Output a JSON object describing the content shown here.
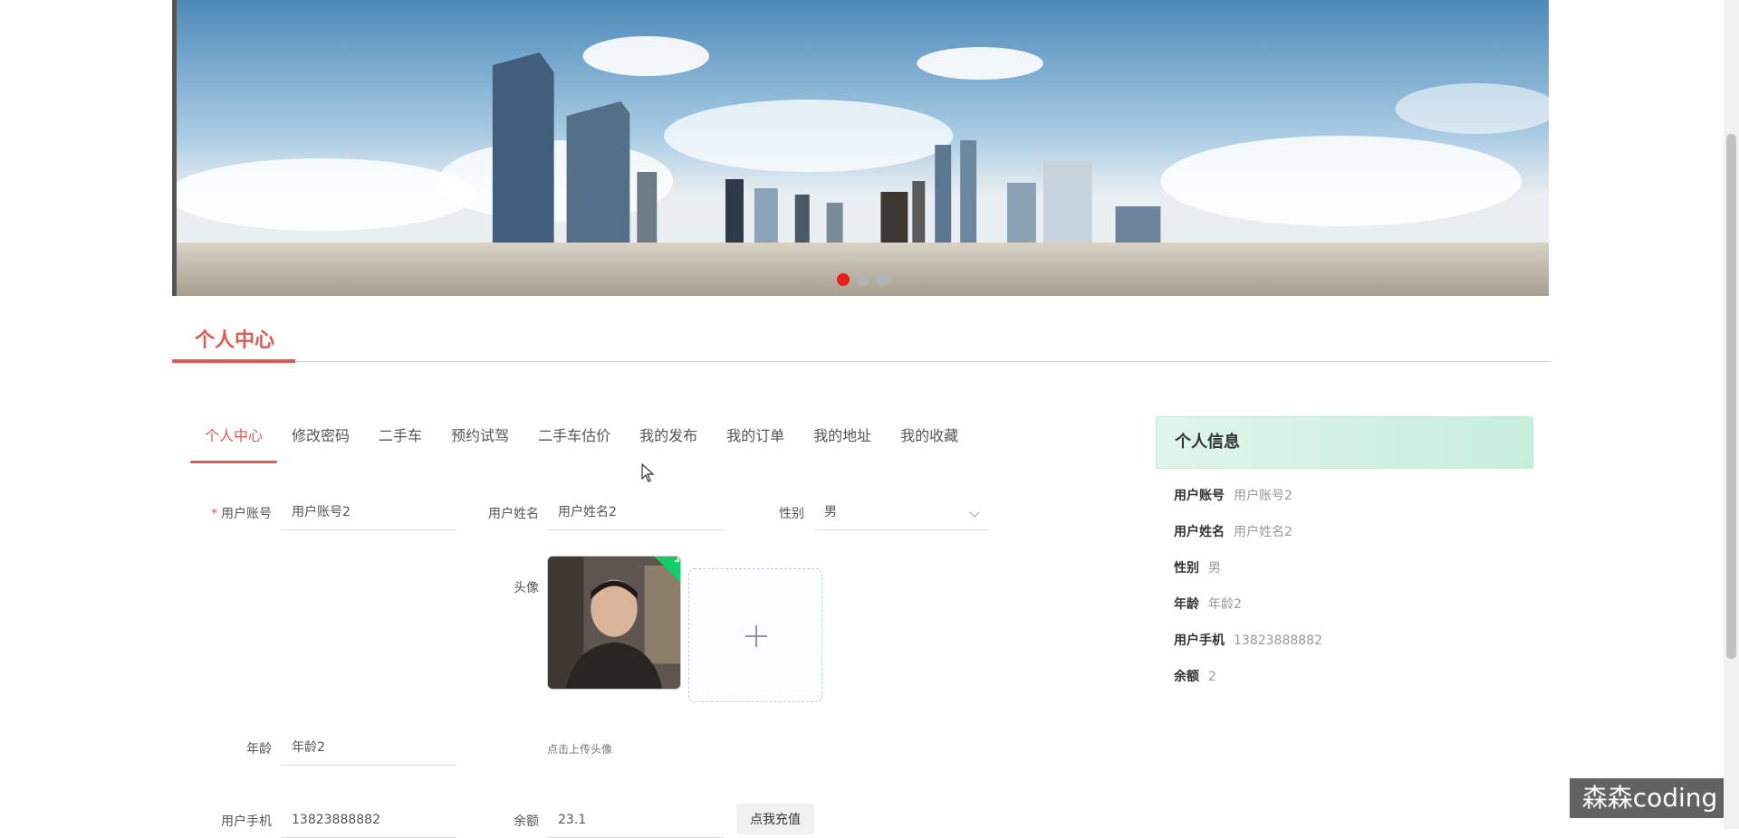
{
  "banner": {
    "slides": 3,
    "active_slide": 1
  },
  "section": {
    "title": "个人中心"
  },
  "tabs": [
    {
      "label": "个人中心",
      "active": true
    },
    {
      "label": "修改密码"
    },
    {
      "label": "二手车"
    },
    {
      "label": "预约试驾"
    },
    {
      "label": "二手车估价"
    },
    {
      "label": "我的发布"
    },
    {
      "label": "我的订单"
    },
    {
      "label": "我的地址"
    },
    {
      "label": "我的收藏"
    }
  ],
  "form": {
    "account_label": "用户账号",
    "account_value": "用户账号2",
    "name_label": "用户姓名",
    "name_value": "用户姓名2",
    "gender_label": "性别",
    "gender_value": "男",
    "avatar_label": "头像",
    "upload_hint": "点击上传头像",
    "age_label": "年龄",
    "age_value": "年龄2",
    "phone_label": "用户手机",
    "phone_value": "13823888882",
    "balance_label": "余额",
    "balance_value": "23.1",
    "recharge_button": "点我充值"
  },
  "info_panel": {
    "title": "个人信息",
    "rows": [
      {
        "key": "用户账号",
        "value": "用户账号2"
      },
      {
        "key": "用户姓名",
        "value": "用户姓名2"
      },
      {
        "key": "性别",
        "value": "男"
      },
      {
        "key": "年龄",
        "value": "年龄2"
      },
      {
        "key": "用户手机",
        "value": "13823888882"
      },
      {
        "key": "余额",
        "value": "2"
      }
    ]
  },
  "watermark": "森森coding",
  "colors": {
    "accent": "#e05a4e",
    "dot_active": "#e8201c",
    "success": "#13ce66"
  }
}
